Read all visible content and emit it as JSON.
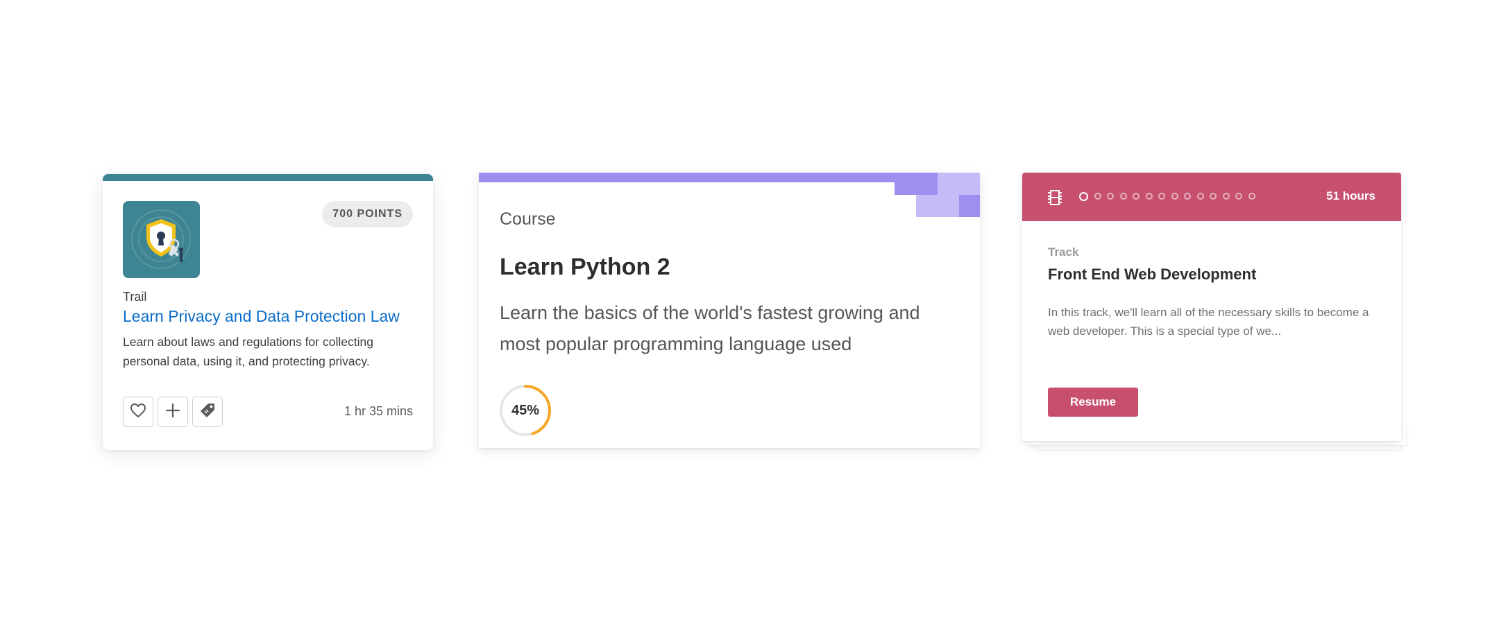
{
  "cards": {
    "trail": {
      "points": "700 POINTS",
      "type": "Trail",
      "title": "Learn Privacy and Data Protection Law",
      "description": "Learn about laws and regulations for collecting personal data, using it, and protecting privacy.",
      "duration": "1 hr 35 mins",
      "icons": [
        "heart-icon",
        "plus-icon",
        "tag-icon"
      ],
      "accent_color": "#3d8593",
      "title_color": "#0b6ec9"
    },
    "course": {
      "type": "Course",
      "title": "Learn Python 2",
      "description": "Learn the basics of the world's fastest growing and most popular programming language used",
      "progress_label": "45%",
      "progress_fraction": 0.45,
      "accent_color": "#9d8ef0",
      "progress_color": "#f5a623"
    },
    "track": {
      "hours": "51 hours",
      "type": "Track",
      "title": "Front End Web Development",
      "description": "In this track, we'll learn all of the necessary skills to become a web developer. This is a special type of we...",
      "resume_label": "Resume",
      "step_count": 14,
      "active_step": 1,
      "accent_color": "#c7506f"
    }
  }
}
